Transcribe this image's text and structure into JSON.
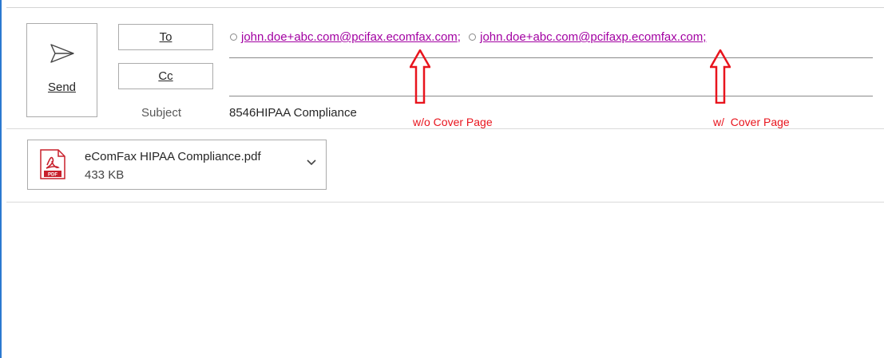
{
  "compose": {
    "send_label": "Send",
    "to_label": "To",
    "cc_label": "Cc",
    "subject_label": "Subject",
    "recipients": [
      {
        "address": "john.doe+abc.com@pcifax.ecomfax.com",
        "separator": ";"
      },
      {
        "address": "john.doe+abc.com@pcifaxp.ecomfax.com",
        "separator": ";"
      }
    ],
    "subject_value": "8546HIPAA Compliance"
  },
  "annotations": {
    "arrow1_label": "w/o Cover Page",
    "arrow2_label": "w/  Cover Page",
    "color": "#e8141d"
  },
  "attachment": {
    "name": "eComFax HIPAA Compliance.pdf",
    "size": "433 KB",
    "icon": "pdf-icon",
    "icon_text": "PDF"
  },
  "colors": {
    "link": "#a200a2",
    "accent": "#2b79d0"
  }
}
